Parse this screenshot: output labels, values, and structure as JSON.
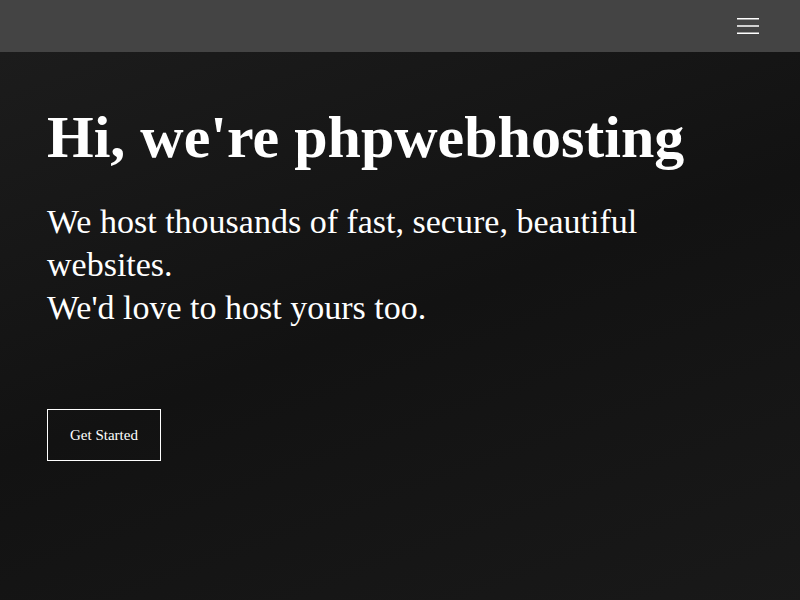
{
  "hero": {
    "title": "Hi, we're phpwebhosting",
    "lines": [
      "We host thousands of fast, secure, beautiful websites.",
      "We'd love to host yours too."
    ],
    "button": "Get Started"
  }
}
